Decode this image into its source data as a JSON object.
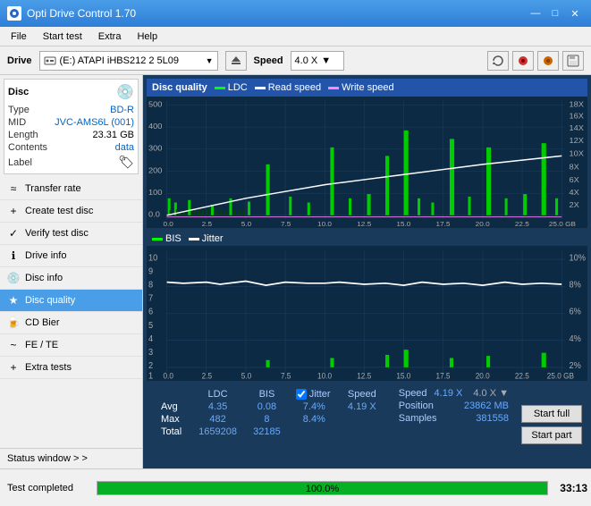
{
  "titleBar": {
    "title": "Opti Drive Control 1.70",
    "minimize": "—",
    "maximize": "□",
    "close": "✕"
  },
  "menuBar": {
    "items": [
      "File",
      "Start test",
      "Extra",
      "Help"
    ]
  },
  "driveBar": {
    "label": "Drive",
    "driveValue": "(E:)  ATAPI iHBS212  2 5L09",
    "speedLabel": "Speed",
    "speedValue": "4.0 X"
  },
  "disc": {
    "title": "Disc",
    "type_label": "Type",
    "type_val": "BD-R",
    "mid_label": "MID",
    "mid_val": "JVC-AMS6L (001)",
    "length_label": "Length",
    "length_val": "23.31 GB",
    "contents_label": "Contents",
    "contents_val": "data",
    "label_label": "Label"
  },
  "nav": {
    "items": [
      {
        "id": "transfer-rate",
        "label": "Transfer rate",
        "icon": "≈"
      },
      {
        "id": "create-test-disc",
        "label": "Create test disc",
        "icon": "+"
      },
      {
        "id": "verify-test-disc",
        "label": "Verify test disc",
        "icon": "✓"
      },
      {
        "id": "drive-info",
        "label": "Drive info",
        "icon": "ℹ"
      },
      {
        "id": "disc-info",
        "label": "Disc info",
        "icon": "💿"
      },
      {
        "id": "disc-quality",
        "label": "Disc quality",
        "icon": "★",
        "active": true
      },
      {
        "id": "cd-bier",
        "label": "CD Bier",
        "icon": "🍺"
      },
      {
        "id": "fe-te",
        "label": "FE / TE",
        "icon": "~"
      },
      {
        "id": "extra-tests",
        "label": "Extra tests",
        "icon": "+"
      }
    ]
  },
  "statusWindow": {
    "label": "Status window > >"
  },
  "statusBar": {
    "text": "Test completed",
    "progressPercent": 100,
    "progressLabel": "100.0%",
    "time": "33:13"
  },
  "chartTop": {
    "title": "Disc quality",
    "legends": [
      "LDC",
      "Read speed",
      "Write speed"
    ],
    "yLeft": [
      500,
      400,
      300,
      200,
      100,
      "0.0"
    ],
    "yRight": [
      "18X",
      "16X",
      "14X",
      "12X",
      "10X",
      "8X",
      "6X",
      "4X",
      "2X"
    ],
    "xLabels": [
      "0.0",
      "2.5",
      "5.0",
      "7.5",
      "10.0",
      "12.5",
      "15.0",
      "17.5",
      "20.0",
      "22.5",
      "25.0 GB"
    ]
  },
  "chartBottom": {
    "legends": [
      "BIS",
      "Jitter"
    ],
    "yLeft": [
      10,
      9,
      8,
      7,
      6,
      5,
      4,
      3,
      2,
      1
    ],
    "yRight": [
      "10%",
      "8%",
      "6%",
      "4%",
      "2%"
    ],
    "xLabels": [
      "0.0",
      "2.5",
      "5.0",
      "7.5",
      "10.0",
      "12.5",
      "15.0",
      "17.5",
      "20.0",
      "22.5",
      "25.0 GB"
    ]
  },
  "stats": {
    "headers": [
      "LDC",
      "BIS",
      "",
      "Jitter",
      "Speed"
    ],
    "rows": [
      {
        "label": "Avg",
        "ldc": "4.35",
        "bis": "0.08",
        "jitter": "7.4%",
        "speed": "4.19 X",
        "speedTarget": "4.0 X"
      },
      {
        "label": "Max",
        "ldc": "482",
        "bis": "8",
        "jitter": "8.4%",
        "position_label": "Position",
        "position": "23862 MB"
      },
      {
        "label": "Total",
        "ldc": "1659208",
        "bis": "32185",
        "samples_label": "Samples",
        "samples": "381558"
      }
    ],
    "jitterChecked": true,
    "jitterLabel": "Jitter"
  },
  "buttons": {
    "startFull": "Start full",
    "startPart": "Start part"
  }
}
